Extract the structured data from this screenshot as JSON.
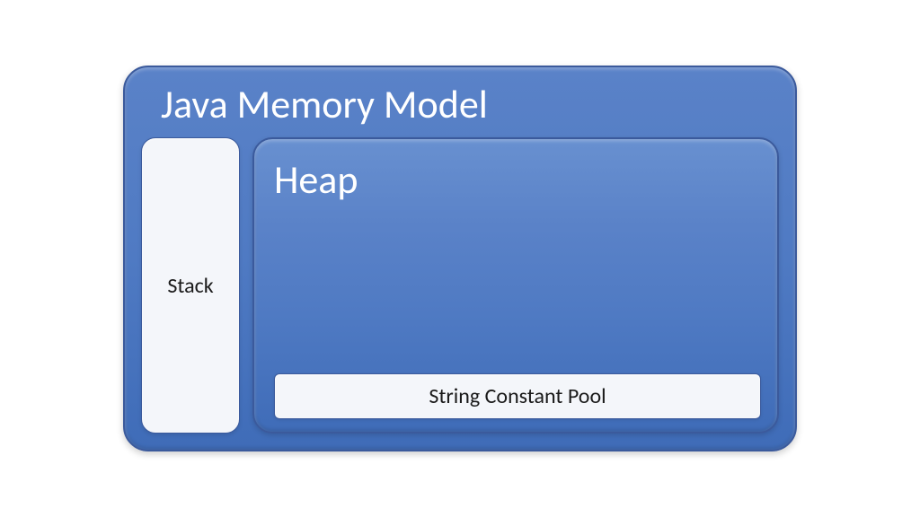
{
  "diagram": {
    "outer_title": "Java Memory Model",
    "stack_label": "Stack",
    "heap_title": "Heap",
    "string_pool_label": "String Constant Pool"
  }
}
